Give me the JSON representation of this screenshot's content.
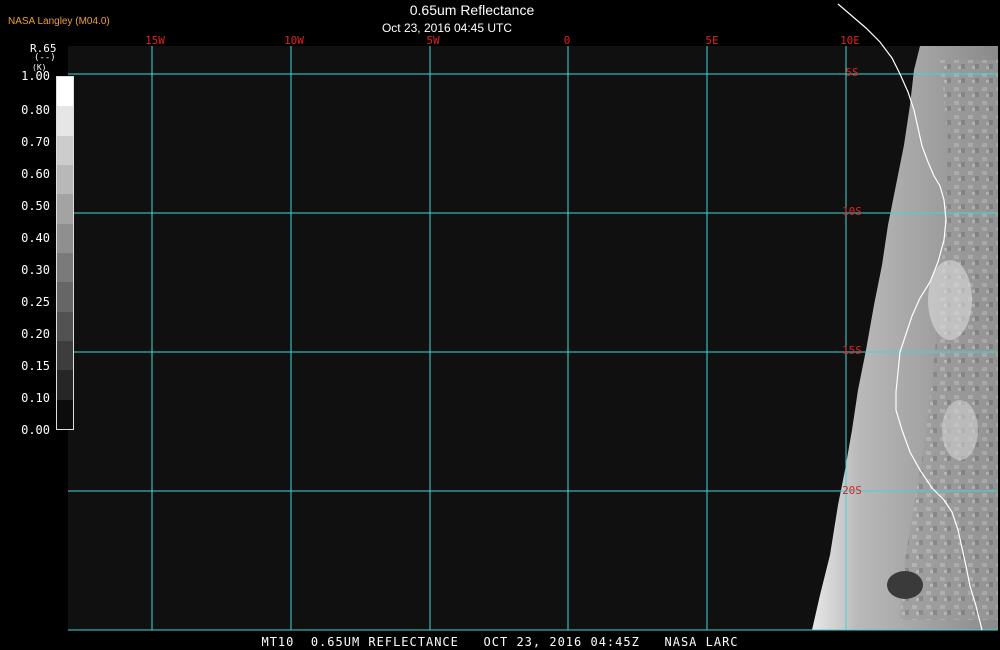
{
  "credit": "NASA Langley (M04.0)",
  "title": "0.65um Reflectance",
  "timestamp": "Oct 23, 2016 04:45 UTC",
  "colorbar": {
    "header_line1": "R.65",
    "header_line2": "(--)",
    "header_line3": "(K)",
    "ticks": [
      "1.00",
      "0.80",
      "0.70",
      "0.60",
      "0.50",
      "0.40",
      "0.30",
      "0.25",
      "0.20",
      "0.15",
      "0.10",
      "0.00"
    ],
    "shades": [
      "#ffffff",
      "#e6e6e6",
      "#cccccc",
      "#b8b8b8",
      "#a3a3a3",
      "#8f8f8f",
      "#7a7a7a",
      "#666666",
      "#525252",
      "#3d3d3d",
      "#262626",
      "#0c0c0c"
    ]
  },
  "longitude_labels": [
    "15W",
    "10W",
    "5W",
    "0",
    "5E",
    "10E"
  ],
  "latitude_labels": [
    "5S",
    "10S",
    "15S",
    "20S"
  ],
  "footer": "MT10  0.65UM REFLECTANCE   OCT 23, 2016 04:45Z   NASA LARC",
  "colors": {
    "ocean": "#101010",
    "grid": "#3fd6d6",
    "grid_label": "#e02020",
    "credit": "#f0a030",
    "coastline": "#ffffff"
  }
}
